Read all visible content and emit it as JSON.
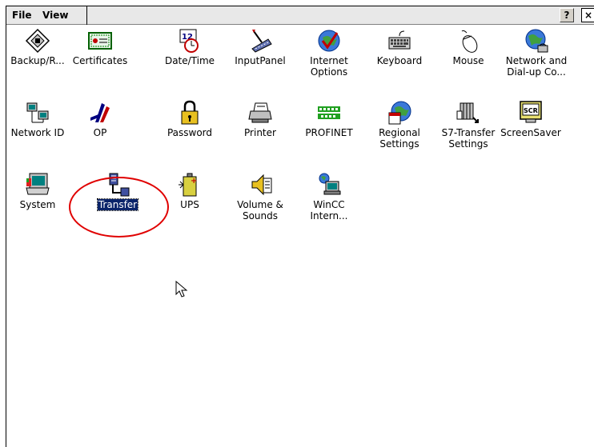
{
  "menu": {
    "file": "File",
    "view": "View"
  },
  "toolbar": {
    "help": "?",
    "close": "×"
  },
  "items": [
    {
      "label": "Backup/R...",
      "icon": "backup-icon"
    },
    {
      "label": "Certificates",
      "icon": "certificates-icon"
    },
    {
      "label": "Date/Time",
      "icon": "date-time-icon"
    },
    {
      "label": "InputPanel",
      "icon": "input-panel-icon"
    },
    {
      "label": "Internet Options",
      "icon": "internet-options-icon"
    },
    {
      "label": "Keyboard",
      "icon": "keyboard-icon"
    },
    {
      "label": "Mouse",
      "icon": "mouse-icon"
    },
    {
      "label": "Network and Dial-up Co...",
      "icon": "network-dialup-icon"
    },
    {
      "label": "Network ID",
      "icon": "network-id-icon"
    },
    {
      "label": "OP",
      "icon": "op-icon"
    },
    {
      "label": "Password",
      "icon": "password-icon"
    },
    {
      "label": "Printer",
      "icon": "printer-icon"
    },
    {
      "label": "PROFINET",
      "icon": "profinet-icon"
    },
    {
      "label": "Regional Settings",
      "icon": "regional-settings-icon"
    },
    {
      "label": "S7-Transfer Settings",
      "icon": "s7-transfer-icon"
    },
    {
      "label": "ScreenSaver",
      "icon": "screensaver-icon"
    },
    {
      "label": "System",
      "icon": "system-icon"
    },
    {
      "label": "Transfer",
      "icon": "transfer-icon",
      "selected": true
    },
    {
      "label": "UPS",
      "icon": "ups-icon"
    },
    {
      "label": "Volume & Sounds",
      "icon": "volume-sounds-icon"
    },
    {
      "label": "WinCC Intern...",
      "icon": "wincc-internet-icon"
    }
  ],
  "colors": {
    "selection": "#0a246a",
    "annotation": "#e00000",
    "menubar": "#e8e8e8"
  }
}
